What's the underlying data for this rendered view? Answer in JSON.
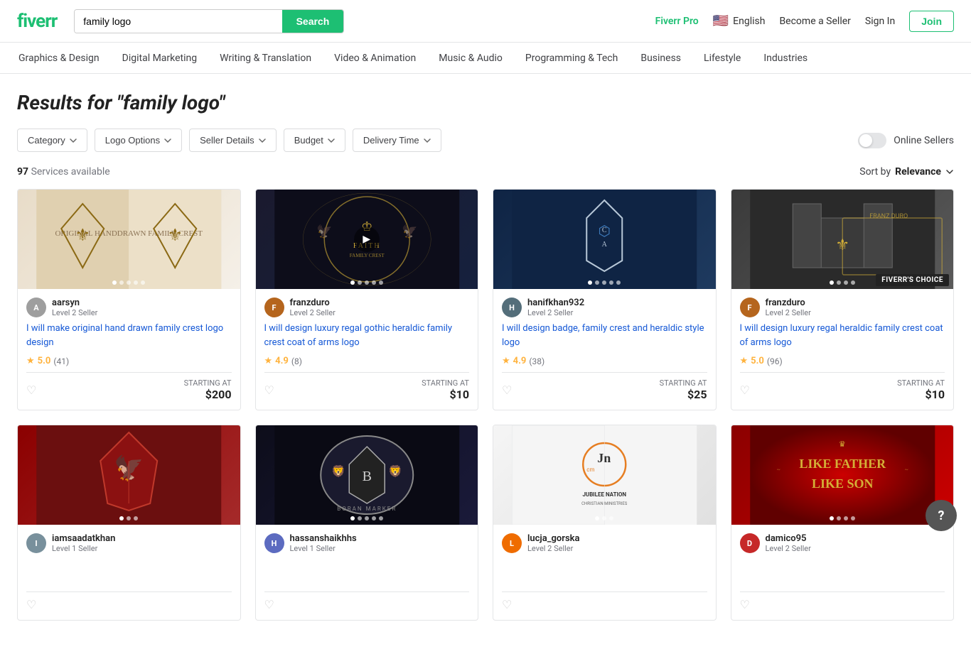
{
  "header": {
    "logo": "fiverr",
    "search_placeholder": "family logo",
    "search_value": "family logo",
    "search_button": "Search",
    "fiverr_pro_label": "Fiverr Pro",
    "language_flag": "🇺🇸",
    "language_label": "English",
    "become_seller": "Become a Seller",
    "sign_in": "Sign In",
    "join": "Join"
  },
  "nav": {
    "items": [
      {
        "label": "Graphics & Design"
      },
      {
        "label": "Digital Marketing"
      },
      {
        "label": "Writing & Translation"
      },
      {
        "label": "Video & Animation"
      },
      {
        "label": "Music & Audio"
      },
      {
        "label": "Programming & Tech"
      },
      {
        "label": "Business"
      },
      {
        "label": "Lifestyle"
      },
      {
        "label": "Industries"
      }
    ]
  },
  "results": {
    "title_prefix": "Results for ",
    "title_query": "\"family logo\"",
    "count": "97",
    "count_label": "Services available",
    "sort_prefix": "Sort by ",
    "sort_value": "Relevance"
  },
  "filters": [
    {
      "label": "Category",
      "id": "category"
    },
    {
      "label": "Logo Options",
      "id": "logo-options"
    },
    {
      "label": "Seller Details",
      "id": "seller-details"
    },
    {
      "label": "Budget",
      "id": "budget"
    },
    {
      "label": "Delivery Time",
      "id": "delivery-time"
    }
  ],
  "online_sellers_label": "Online Sellers",
  "cards": [
    {
      "id": "card-1",
      "bg_class": "bg-beige",
      "has_play": false,
      "dots": 5,
      "active_dot": 0,
      "avatar_color": "#9e9e9e",
      "avatar_initials": "A",
      "seller_name": "aarsyn",
      "seller_level": "Level 2 Seller",
      "title": "I will make original hand drawn family crest logo design",
      "title_link": true,
      "rating": "5.0",
      "rating_count": "(41)",
      "price": "$200",
      "starting_at": "STARTING AT",
      "fiverrs_choice": false
    },
    {
      "id": "card-2",
      "bg_class": "bg-dark",
      "has_play": true,
      "dots": 5,
      "active_dot": 0,
      "avatar_color": "#b5651d",
      "avatar_initials": "F",
      "seller_name": "franzduro",
      "seller_level": "Level 2 Seller",
      "title": "I will design luxury regal gothic heraldic family crest coat of arms logo",
      "title_link": true,
      "rating": "4.9",
      "rating_count": "(8)",
      "price": "$10",
      "starting_at": "STARTING AT",
      "fiverrs_choice": false
    },
    {
      "id": "card-3",
      "bg_class": "bg-navy",
      "has_play": false,
      "dots": 5,
      "active_dot": 0,
      "avatar_color": "#546e7a",
      "avatar_initials": "H",
      "seller_name": "hanifkhan932",
      "seller_level": "Level 2 Seller",
      "title": "I will design badge, family crest and heraldic style logo",
      "title_link": true,
      "rating": "4.9",
      "rating_count": "(38)",
      "price": "$25",
      "starting_at": "STARTING AT",
      "fiverrs_choice": false
    },
    {
      "id": "card-4",
      "bg_class": "bg-gray",
      "has_play": false,
      "dots": 4,
      "active_dot": 0,
      "avatar_color": "#b5651d",
      "avatar_initials": "F",
      "seller_name": "franzduro",
      "seller_level": "Level 2 Seller",
      "title": "I will design luxury regal heraldic family crest coat of arms logo",
      "title_link": true,
      "rating": "5.0",
      "rating_count": "(96)",
      "price": "$10",
      "starting_at": "STARTING AT",
      "fiverrs_choice": true
    },
    {
      "id": "card-5",
      "bg_class": "bg-red",
      "has_play": false,
      "dots": 3,
      "active_dot": 0,
      "avatar_color": "#78909c",
      "avatar_initials": "I",
      "seller_name": "iamsaadatkhan",
      "seller_level": "Level 1 Seller",
      "title": "",
      "title_link": false,
      "rating": "",
      "rating_count": "",
      "price": "",
      "starting_at": "",
      "fiverrs_choice": false
    },
    {
      "id": "card-6",
      "bg_class": "bg-darkblue",
      "has_play": false,
      "dots": 5,
      "active_dot": 0,
      "avatar_color": "#5c6bc0",
      "avatar_initials": "H",
      "seller_name": "hassanshaikhhs",
      "seller_level": "Level 1 Seller",
      "title": "",
      "title_link": false,
      "rating": "",
      "rating_count": "",
      "price": "",
      "starting_at": "",
      "fiverrs_choice": false
    },
    {
      "id": "card-7",
      "bg_class": "bg-orange",
      "has_play": false,
      "dots": 3,
      "active_dot": 0,
      "avatar_color": "#ef6c00",
      "avatar_initials": "L",
      "seller_name": "lucja_gorska",
      "seller_level": "Level 2 Seller",
      "title": "",
      "title_link": false,
      "rating": "",
      "rating_count": "",
      "price": "",
      "starting_at": "",
      "fiverrs_choice": false
    },
    {
      "id": "card-8",
      "bg_class": "bg-darkred",
      "has_play": false,
      "dots": 4,
      "active_dot": 0,
      "avatar_color": "#c62828",
      "avatar_initials": "D",
      "seller_name": "damico95",
      "seller_level": "Level 2 Seller",
      "title": "",
      "title_link": false,
      "rating": "",
      "rating_count": "",
      "price": "",
      "starting_at": "",
      "fiverrs_choice": false
    }
  ],
  "fiverrs_choice_label": "FIVERR'S CHOICE",
  "help_icon": "?"
}
